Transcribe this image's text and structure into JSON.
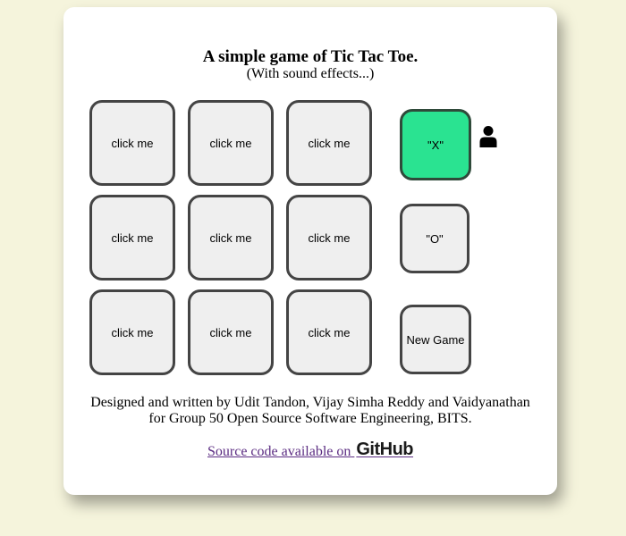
{
  "header": {
    "title": "A simple game of Tic Tac Toe.",
    "subtitle": "(With sound effects...)"
  },
  "board": {
    "cells": [
      "click me",
      "click me",
      "click me",
      "click me",
      "click me",
      "click me",
      "click me",
      "click me",
      "click me"
    ]
  },
  "controls": {
    "x_label": "\"X\"",
    "o_label": "\"O\"",
    "new_game_label": "New Game",
    "selected_player": "X",
    "player_icon": "user-icon"
  },
  "footer": {
    "credits_line1": "Designed and written by Udit Tandon, Vijay Simha Reddy and Vaidyanathan",
    "credits_line2": "for Group 50 Open Source Software Engineering, BITS.",
    "source_text": "Source code available on",
    "logo_text": "GitHub"
  },
  "colors": {
    "page_background": "#f5f4dc",
    "selected_button": "#2ae391",
    "link": "#5b2c82"
  }
}
